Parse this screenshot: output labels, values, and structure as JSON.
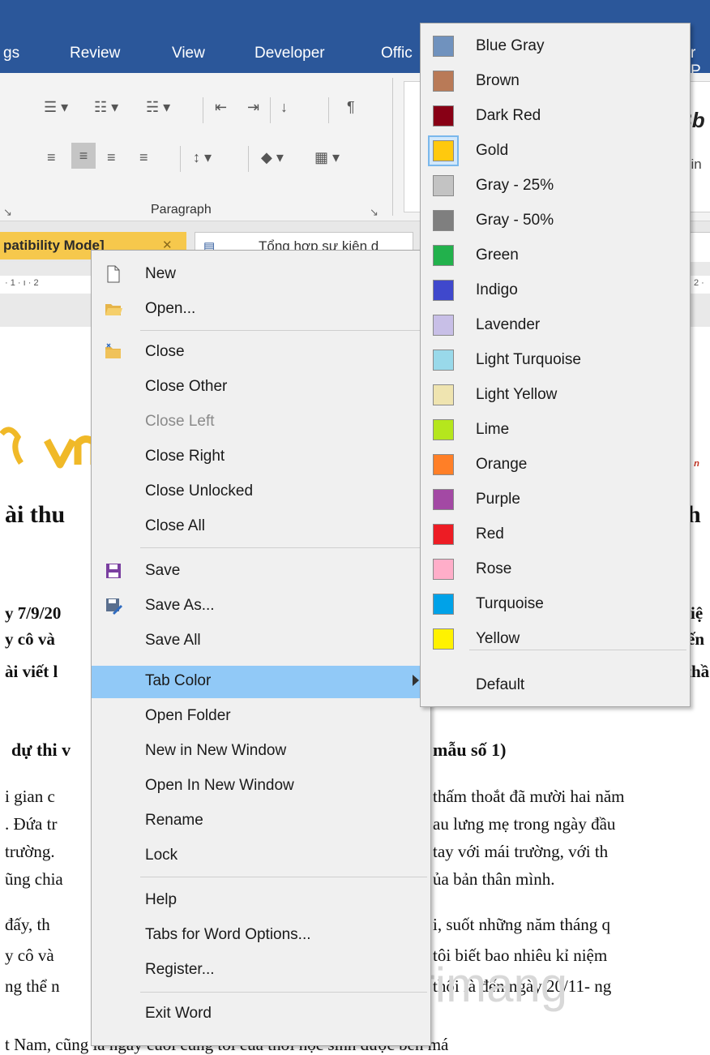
{
  "ribbon": {
    "tabs": [
      "gs",
      "Review",
      "View",
      "Developer",
      "Offic",
      "r P"
    ],
    "paragraph_group": "Paragraph",
    "styles_partial": [
      "Bb",
      "din"
    ]
  },
  "tabs_bar": {
    "active_tab": "patibility Mode]",
    "second_tab": "Tổng hợp sự kiện d"
  },
  "ruler": {
    "left": "· 1 · ı · 2",
    "right": "2 ·"
  },
  "document": {
    "lines": [
      "ài thu",
      "th",
      "y 7/9/20",
      "iệ",
      "y cô và",
      "ến",
      "ài viết l",
      "thầ",
      "dự thi v",
      "mẫu số 1)",
      "i gian c",
      "thấm thoắt đã mười hai năm",
      ". Đứa tr",
      "au lưng mẹ trong ngày đầu",
      " trường.",
      "tay với mái trường, với th",
      "ũng chia",
      "ủa bản thân mình.",
      " đấy, th",
      "i, suốt những năm tháng q",
      "y cô và",
      "tôi biết bao nhiêu kỉ niệm",
      "ng thể n",
      "thôi là đến ngày 20/11- ng",
      "t Nam, cũng là ngày cuối cùng  tôi  của thời học sinh được bên má"
    ],
    "watermark": "uantrimang"
  },
  "context_menu": {
    "items": [
      {
        "label": "New",
        "icon": "new-document-icon"
      },
      {
        "label": "Open...",
        "icon": "open-folder-icon"
      },
      {
        "label": "Close",
        "icon": "close-folder-icon"
      },
      {
        "label": "Close Other"
      },
      {
        "label": "Close Left",
        "disabled": true
      },
      {
        "label": "Close Right"
      },
      {
        "label": "Close Unlocked"
      },
      {
        "label": "Close All"
      },
      {
        "label": "Save",
        "icon": "save-icon"
      },
      {
        "label": "Save As...",
        "icon": "save-as-icon"
      },
      {
        "label": "Save All"
      },
      {
        "label": "Tab Color",
        "highlighted": true,
        "submenu": true
      },
      {
        "label": "Open Folder"
      },
      {
        "label": "New in New Window"
      },
      {
        "label": "Open In New Window"
      },
      {
        "label": "Rename"
      },
      {
        "label": "Lock"
      },
      {
        "label": "Help"
      },
      {
        "label": "Tabs for Word Options..."
      },
      {
        "label": "Register..."
      },
      {
        "label": "Exit Word"
      }
    ]
  },
  "tab_color_menu": {
    "items": [
      {
        "label": "Blue Gray",
        "color": "#7092be"
      },
      {
        "label": "Brown",
        "color": "#b97a57"
      },
      {
        "label": "Dark Red",
        "color": "#880015"
      },
      {
        "label": "Gold",
        "color": "#ffc90e",
        "selected": true
      },
      {
        "label": "Gray - 25%",
        "color": "#c3c3c3"
      },
      {
        "label": "Gray - 50%",
        "color": "#7f7f7f"
      },
      {
        "label": "Green",
        "color": "#22b14c"
      },
      {
        "label": "Indigo",
        "color": "#3f48cc"
      },
      {
        "label": "Lavender",
        "color": "#c8bfe7"
      },
      {
        "label": "Light Turquoise",
        "color": "#99d9ea"
      },
      {
        "label": "Light Yellow",
        "color": "#efe4b0"
      },
      {
        "label": "Lime",
        "color": "#b5e61d"
      },
      {
        "label": "Orange",
        "color": "#ff7f27"
      },
      {
        "label": "Purple",
        "color": "#a349a4"
      },
      {
        "label": "Red",
        "color": "#ed1c24"
      },
      {
        "label": "Rose",
        "color": "#ffaec9"
      },
      {
        "label": "Turquoise",
        "color": "#00a2e8"
      },
      {
        "label": "Yellow",
        "color": "#fff200"
      }
    ],
    "default_label": "Default"
  }
}
